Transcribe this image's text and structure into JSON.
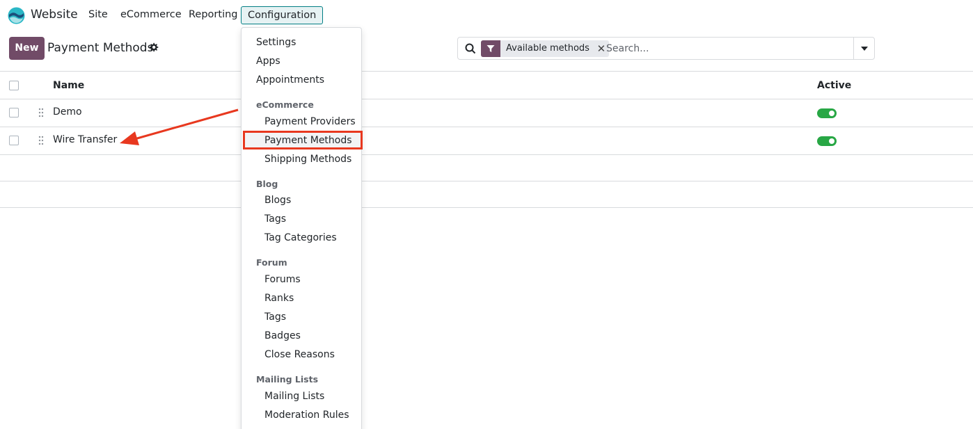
{
  "navbar": {
    "app_name": "Website",
    "menus": [
      "Site",
      "eCommerce",
      "Reporting"
    ],
    "active_menu": "Configuration"
  },
  "control_panel": {
    "new_label": "New",
    "title": "Payment Methods"
  },
  "search": {
    "facet_label": "Available methods",
    "placeholder": "Search..."
  },
  "list": {
    "columns": {
      "name": "Name",
      "active": "Active"
    },
    "rows": [
      {
        "name": "Demo",
        "active": true
      },
      {
        "name": "Wire Transfer",
        "active": true
      }
    ]
  },
  "dropdown": {
    "items": [
      "Settings",
      "Apps",
      "Appointments"
    ],
    "sections": [
      {
        "header": "eCommerce",
        "items": [
          "Payment Providers",
          "Payment Methods",
          "Shipping Methods"
        ]
      },
      {
        "header": "Blog",
        "items": [
          "Blogs",
          "Tags",
          "Tag Categories"
        ]
      },
      {
        "header": "Forum",
        "items": [
          "Forums",
          "Ranks",
          "Tags",
          "Badges",
          "Close Reasons"
        ]
      },
      {
        "header": "Mailing Lists",
        "items": [
          "Mailing Lists",
          "Moderation Rules"
        ]
      }
    ]
  },
  "colors": {
    "brand": "#714b67",
    "active_menu_border": "#017e84",
    "toggle_on": "#28a745",
    "annotation": "#e8381f"
  }
}
